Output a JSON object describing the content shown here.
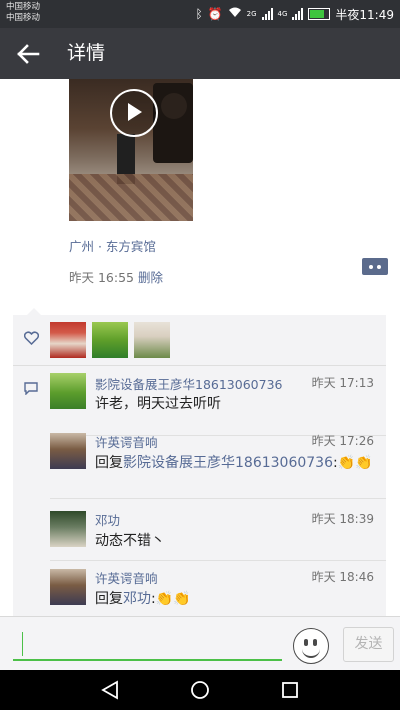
{
  "status_bar": {
    "carrier_1": "中国移动",
    "carrier_2": "中国移动",
    "net_1": "2G",
    "net_2": "4G",
    "time": "半夜11:49"
  },
  "header": {
    "title": "详情"
  },
  "post": {
    "location": "广州 · 东方宾馆",
    "time": "昨天 16:55",
    "delete_label": "删除"
  },
  "comments": [
    {
      "name": "影院设备展王彦华18613060736",
      "time": "昨天 17:13",
      "text": "许老，明天过去听听"
    },
    {
      "name": "许英谔音响",
      "time": "昨天 17:26",
      "reply_prefix": "回复",
      "reply_to": "影院设备展王彦华18613060736",
      "text": ":👏👏"
    },
    {
      "name": "邓功",
      "time": "昨天 18:39",
      "text": "动态不错丶"
    },
    {
      "name": "许英谔音响",
      "time": "昨天 18:46",
      "reply_prefix": "回复",
      "reply_to": "邓功",
      "text": ":👏👏"
    }
  ],
  "input": {
    "send_label": "发送",
    "placeholder": ""
  },
  "colors": {
    "link": "#576b95",
    "accent": "#4cc048",
    "appbar": "#393a3f"
  }
}
